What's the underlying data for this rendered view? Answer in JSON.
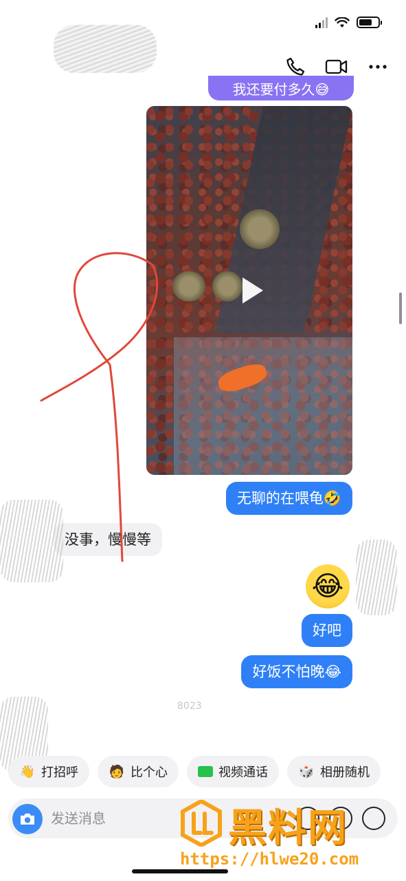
{
  "header": {
    "icons": [
      "phone-icon",
      "video-call-icon",
      "more-icon"
    ]
  },
  "messages": [
    {
      "side": "me",
      "type": "text",
      "text": "我还要付多久😅"
    },
    {
      "side": "me",
      "type": "video"
    },
    {
      "side": "me",
      "type": "text",
      "text": "无聊的在喂龟🤣"
    },
    {
      "side": "other",
      "type": "text",
      "text": "没事，慢慢等"
    },
    {
      "side": "me",
      "type": "sticker",
      "text": "😂"
    },
    {
      "side": "me",
      "type": "text",
      "text": "好吧"
    },
    {
      "side": "me",
      "type": "text",
      "text": "好饭不怕晚😂"
    }
  ],
  "timestamp": "8023",
  "quick_actions": [
    {
      "label": "打招呼",
      "icon": "wave-icon"
    },
    {
      "label": "比个心",
      "icon": "avatar-heart-icon"
    },
    {
      "label": "视频通话",
      "icon": "video-icon"
    },
    {
      "label": "相册随机",
      "icon": "dice-icon"
    }
  ],
  "input": {
    "placeholder": "发送消息"
  },
  "watermark": {
    "title": "黑料网",
    "url": "https://hlwe20.com"
  },
  "colors": {
    "my_bubble": "#2f80f6",
    "other_bubble": "#f1f1f3",
    "accent_purple": "#8a73f2",
    "watermark": "#f7a21a"
  }
}
